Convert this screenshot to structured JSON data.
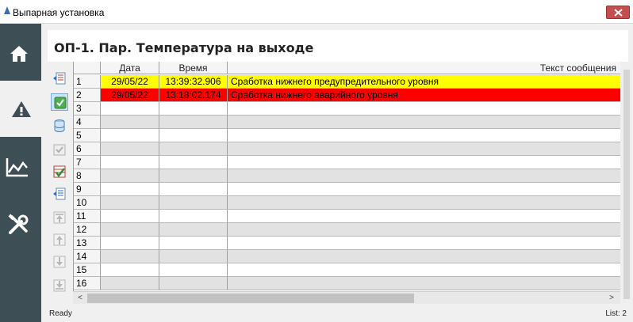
{
  "window": {
    "title": "Выпарная установка"
  },
  "nav": {
    "items": [
      "home",
      "alarms",
      "trends",
      "tools"
    ],
    "active": "alarms"
  },
  "panel": {
    "title": "ОП-1. Пар. Температура на выходе"
  },
  "table": {
    "columns": [
      "",
      "Дата",
      "Время",
      "Текст сообщения"
    ],
    "rows": [
      {
        "num": "1",
        "date": "29/05/22",
        "time": "13:39:32.906",
        "message": "Сработка нижнего предупредительного уровня",
        "level": "warning"
      },
      {
        "num": "2",
        "date": "29/05/22",
        "time": "13:18:02.174",
        "message": "Сработка нижнего аварийного уровня",
        "level": "critical"
      },
      {
        "num": "3",
        "date": "",
        "time": "",
        "message": ""
      },
      {
        "num": "4",
        "date": "",
        "time": "",
        "message": ""
      },
      {
        "num": "5",
        "date": "",
        "time": "",
        "message": ""
      },
      {
        "num": "6",
        "date": "",
        "time": "",
        "message": ""
      },
      {
        "num": "7",
        "date": "",
        "time": "",
        "message": ""
      },
      {
        "num": "8",
        "date": "",
        "time": "",
        "message": ""
      },
      {
        "num": "9",
        "date": "",
        "time": "",
        "message": ""
      },
      {
        "num": "10",
        "date": "",
        "time": "",
        "message": ""
      },
      {
        "num": "11",
        "date": "",
        "time": "",
        "message": ""
      },
      {
        "num": "12",
        "date": "",
        "time": "",
        "message": ""
      },
      {
        "num": "13",
        "date": "",
        "time": "",
        "message": ""
      },
      {
        "num": "14",
        "date": "",
        "time": "",
        "message": ""
      },
      {
        "num": "15",
        "date": "",
        "time": "",
        "message": ""
      },
      {
        "num": "16",
        "date": "",
        "time": "",
        "message": ""
      }
    ]
  },
  "colors": {
    "warning": "#ffff00",
    "critical": "#ff0000",
    "nav_bg": "#3e4e55"
  },
  "status": {
    "left": "Ready",
    "right": "List: 2"
  }
}
